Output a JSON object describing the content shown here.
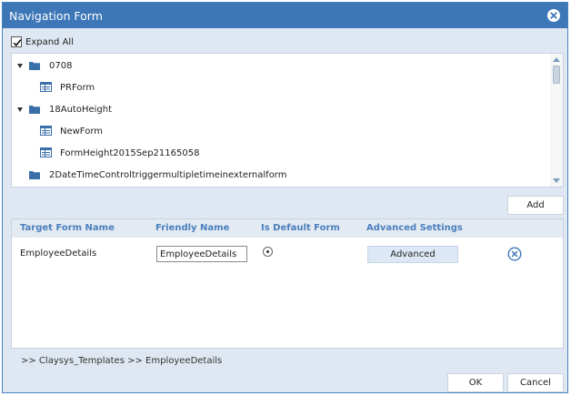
{
  "window": {
    "title": "Navigation Form",
    "close_icon": "close-circle-icon"
  },
  "options": {
    "expand_all_label": "Expand All",
    "expand_all_checked": true
  },
  "tree": {
    "items": [
      {
        "label": "0708",
        "type": "folder",
        "expanded": true,
        "level": 0
      },
      {
        "label": "PRForm",
        "type": "form",
        "level": 1
      },
      {
        "label": "18AutoHeight",
        "type": "folder",
        "expanded": true,
        "level": 0
      },
      {
        "label": "NewForm",
        "type": "form",
        "level": 1
      },
      {
        "label": "FormHeight2015Sep21165058",
        "type": "form",
        "level": 1
      },
      {
        "label": "2DateTimeControltriggermultipletimeinexternalform",
        "type": "folder",
        "expanded": false,
        "level": 0
      }
    ]
  },
  "toolbar": {
    "add_label": "Add"
  },
  "mapping": {
    "columns": [
      "Target Form Name",
      "Friendly Name",
      "Is Default Form",
      "Advanced Settings"
    ],
    "rows": [
      {
        "target_form_name": "EmployeeDetails",
        "friendly_name": "EmployeeDetails",
        "is_default": true,
        "advanced_label": "Advanced"
      }
    ]
  },
  "breadcrumb": {
    "text": ">> Claysys_Templates >> EmployeeDetails"
  },
  "footer": {
    "ok_label": "OK",
    "cancel_label": "Cancel"
  },
  "colors": {
    "titlebar": "#3d77b8",
    "header_text": "#4a7fbd",
    "folder": "#3a6fa8"
  }
}
